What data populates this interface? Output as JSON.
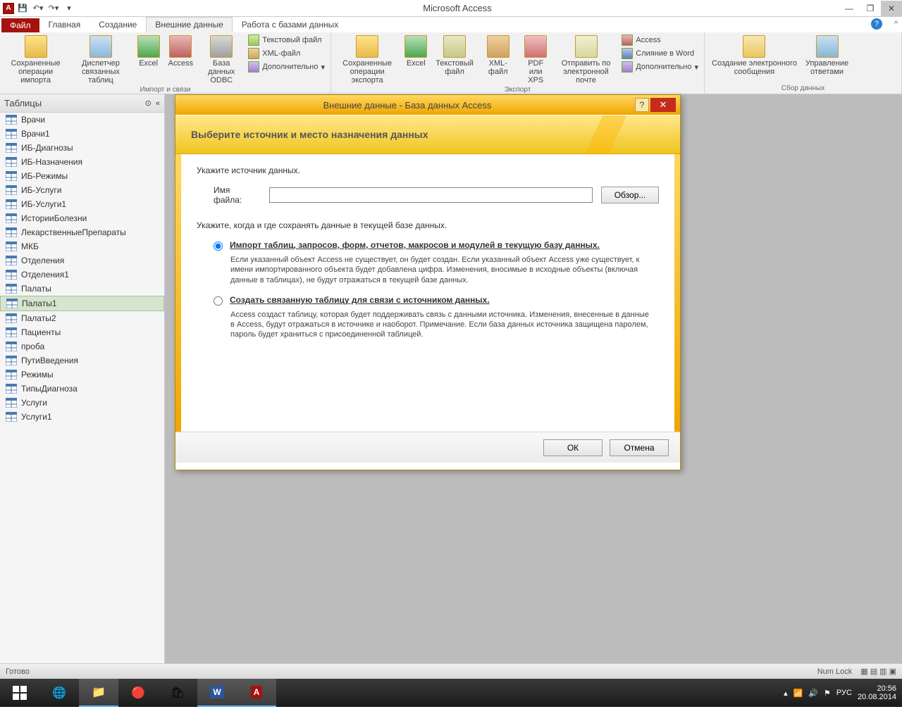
{
  "app": {
    "title": "Microsoft Access"
  },
  "tabs": {
    "file": "Файл",
    "home": "Главная",
    "create": "Создание",
    "external": "Внешние данные",
    "database": "Работа с базами данных"
  },
  "ribbon": {
    "group1": {
      "label": "Импорт и связи",
      "saved_imports": "Сохраненные\nоперации импорта",
      "link_manager": "Диспетчер\nсвязанных таблиц",
      "excel": "Excel",
      "access": "Access",
      "odbc": "База данных\nODBC",
      "text": "Текстовый файл",
      "xml": "XML-файл",
      "more": "Дополнительно"
    },
    "group2": {
      "label": "Экспорт",
      "saved_exports": "Сохраненные\nоперации экспорта",
      "excel": "Excel",
      "text": "Текстовый\nфайл",
      "xml": "XML-файл",
      "pdf": "PDF\nили XPS",
      "email": "Отправить по\nэлектронной почте",
      "access": "Access",
      "word": "Слияние в Word",
      "more": "Дополнительно"
    },
    "group3": {
      "label": "Сбор данных",
      "create_msg": "Создание электронного\nсообщения",
      "manage": "Управление\nответами"
    }
  },
  "nav": {
    "header": "Таблицы",
    "items": [
      "Врачи",
      "Врачи1",
      "ИБ-Диагнозы",
      "ИБ-Назначения",
      "ИБ-Режимы",
      "ИБ-Услуги",
      "ИБ-Услуги1",
      "ИсторииБолезни",
      "ЛекарственныеПрепараты",
      "МКБ",
      "Отделения",
      "Отделения1",
      "Палаты",
      "Палаты1",
      "Палаты2",
      "Пациенты",
      "проба",
      "ПутиВведения",
      "Режимы",
      "ТипыДиагноза",
      "Услуги",
      "Услуги1"
    ],
    "selected_index": 13
  },
  "dialog": {
    "title": "Внешние данные - База данных Access",
    "banner": "Выберите источник и место назначения данных",
    "src_label": "Укажите источник данных.",
    "file_label": "Имя файла:",
    "file_value": "",
    "browse": "Обзор...",
    "dest_label": "Укажите, когда и где сохранять данные в текущей базе данных.",
    "opt1_label": "Импорт таблиц, запросов, форм, отчетов, макросов и модулей в текущую базу данных.",
    "opt1_desc": "Если указанный объект Access не существует, он будет создан. Если указанный объект Access уже существует, к имени импортированного объекта будет добавлена цифра. Изменения, вносимые в исходные объекты (включая данные в таблицах), не будут отражаться в текущей базе данных.",
    "opt2_label": "Создать связанную таблицу для связи с источником данных.",
    "opt2_desc": "Access создаст таблицу, которая будет поддерживать связь с данными источника. Изменения, внесенные в данные в Access, будут отражаться в источнике и наоборот. Примечание. Если база данных источника защищена паролем, пароль будет храниться с присоединенной таблицей.",
    "ok": "ОК",
    "cancel": "Отмена"
  },
  "status": {
    "ready": "Готово",
    "numlock": "Num Lock"
  },
  "tray": {
    "lang": "РУС",
    "time": "20:56",
    "date": "20.08.2014"
  }
}
